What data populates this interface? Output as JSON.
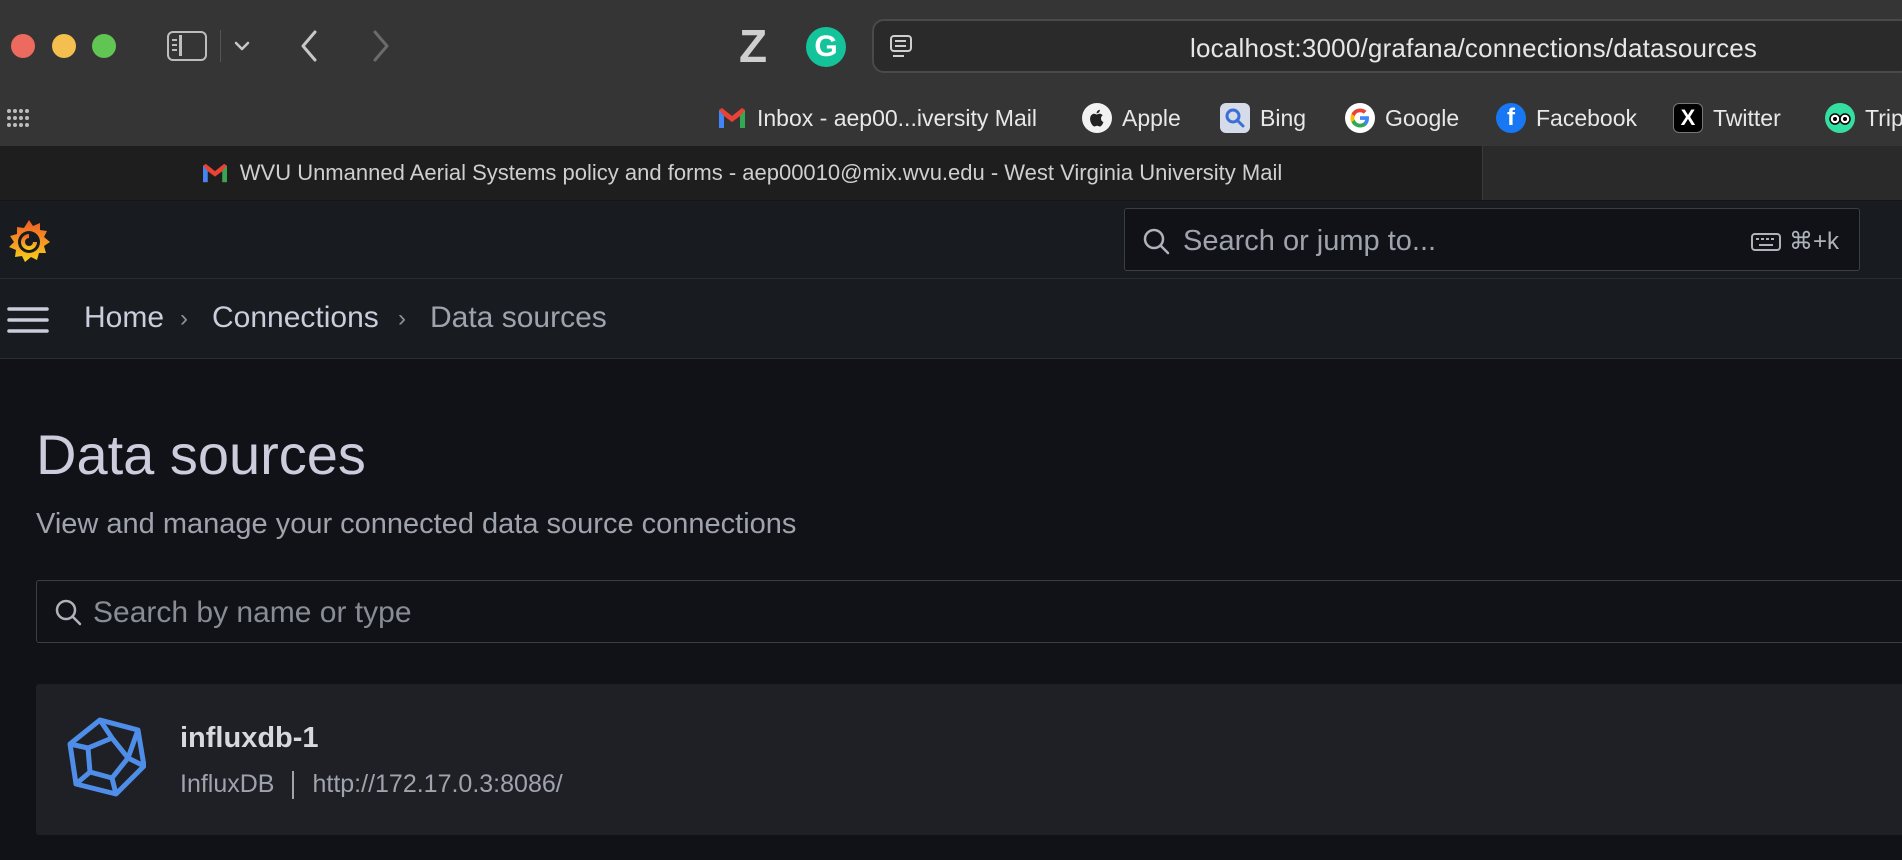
{
  "browser": {
    "url": "localhost:3000/grafana/connections/datasources",
    "zotero_glyph": "Z",
    "grammarly_glyph": "G"
  },
  "favorites": [
    {
      "label": "Inbox - aep00...iversity Mail",
      "icon": "gmail-icon"
    },
    {
      "label": "Apple",
      "icon": "apple-icon"
    },
    {
      "label": "Bing",
      "icon": "bing-icon"
    },
    {
      "label": "Google",
      "icon": "google-icon"
    },
    {
      "label": "Facebook",
      "icon": "facebook-icon"
    },
    {
      "label": "Twitter",
      "icon": "twitter-icon"
    },
    {
      "label": "Trip",
      "icon": "tripadvisor-icon"
    }
  ],
  "tab": {
    "title": "WVU Unmanned Aerial Systems policy and forms - aep00010@mix.wvu.edu - West Virginia University Mail"
  },
  "grafana": {
    "search_placeholder": "Search or jump to...",
    "search_shortcut": "⌘+k",
    "breadcrumbs": [
      "Home",
      "Connections",
      "Data sources"
    ],
    "page_title": "Data sources",
    "page_subtitle": "View and manage your connected data source connections",
    "ds_search_placeholder": "Search by name or type",
    "datasources": [
      {
        "name": "influxdb-1",
        "type": "InfluxDB",
        "url": "http://172.17.0.3:8086/"
      }
    ]
  },
  "colors": {
    "grafana_bg": "#111217",
    "influx_blue": "#4f8ee8",
    "grafana_orange": "#f05a28"
  }
}
